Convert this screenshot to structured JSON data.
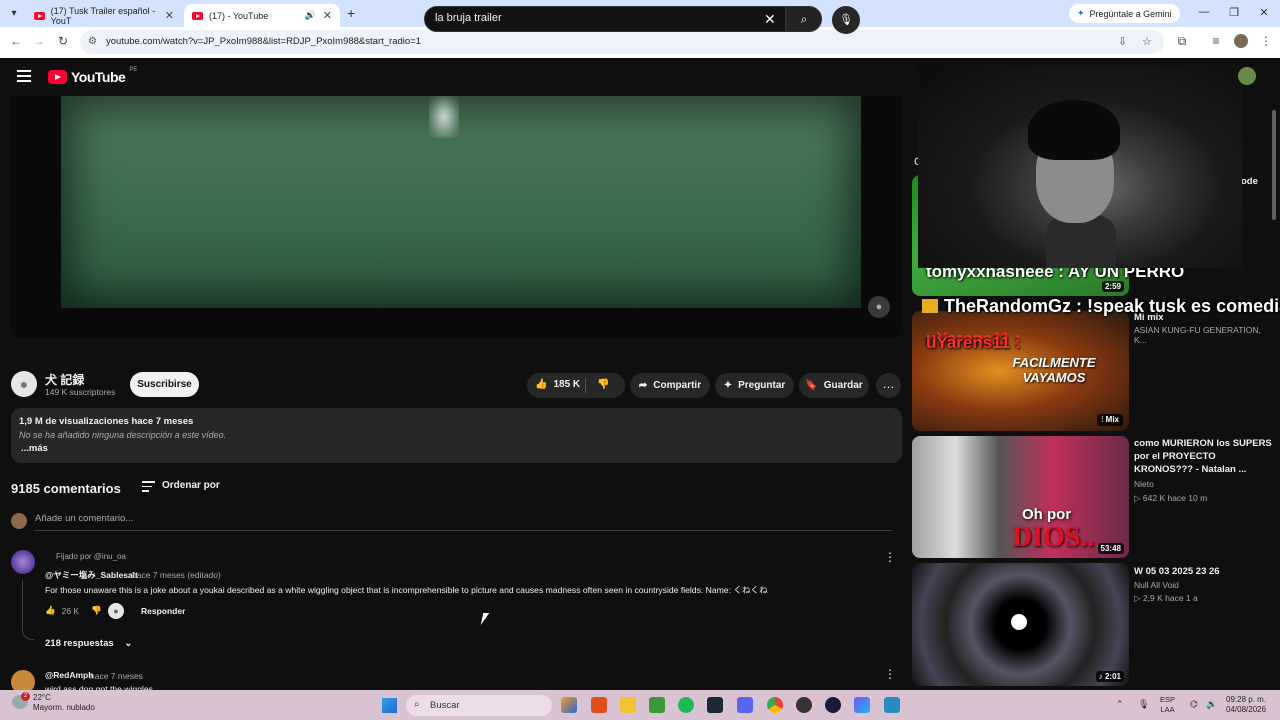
{
  "browser": {
    "tabs": [
      {
        "label": "(17) Tusk Trailer español - YouT",
        "active": false
      },
      {
        "label": "(17)       - YouTube",
        "active": true
      }
    ],
    "new_tab_icon": "plus-icon",
    "gemini_label": "Pregúntale a Gemini",
    "url": "youtube.com/watch?v=JP_PxoIm988&list=RDJP_PxoIm988&start_radio=1"
  },
  "youtube": {
    "logo_text": "YouTube",
    "country_code": "PE",
    "search": {
      "value": "la bruja trailer",
      "placeholder": "Buscar"
    }
  },
  "video": {
    "channel_name": "犬 記録",
    "subscribers": "149 K suscriptores",
    "subscribe_label": "Suscribirse",
    "likes": "185 K",
    "share_label": "Compartir",
    "ask_label": "Preguntar",
    "save_label": "Guardar",
    "stats": "1,9 M de visualizaciones  hace 7 meses",
    "description": "No se ha añadido ninguna descripción a este vídeo.",
    "more_label": "...más"
  },
  "comments": {
    "count_label": "9185 comentarios",
    "sort_label": "Ordenar por",
    "input_placeholder": "Añade un comentario...",
    "items": [
      {
        "pinned_label": "Fijado por @inu_oa",
        "author": "@ヤミー塩み_Sablesalt",
        "time": "hace 7 meses (editado)",
        "text": "For those unaware this is a joke about a youkai described as a white wiggling object that is incomprehensible to picture and causes madness often seen in countryside fields. Name: くねくね",
        "likes": "26 K",
        "reply_label": "Responder",
        "replies_label": "218 respuestas"
      },
      {
        "author": "@RedAmph",
        "time": "hace 7 meses",
        "text": "wird ass dog got the wiggles"
      }
    ]
  },
  "sidebar": {
    "cut_letter": "C",
    "cut_text": "ode",
    "items": [
      {
        "duration": "2:59"
      },
      {
        "title": "Mi mix",
        "channel": "ASIAN KUNG-FU GENERATION, K...",
        "badge": "Mix",
        "thumb_text1": "uYarens11 :",
        "thumb_text2": "FACILMENTE VAYAMOS"
      },
      {
        "title": "como MURIERON los SUPERS por el PROYECTO KRONOS??? - Natalan ...",
        "channel": "Nieto",
        "meta": "642 K  hace 10 m",
        "duration": "53:48",
        "thumb_text1": "Oh por",
        "thumb_text2": "DIOS.."
      },
      {
        "title": "W 05 03 2025 23 26",
        "channel": "Null All Void",
        "meta": "2,9 K  hace 1 a",
        "duration": "2:01"
      }
    ]
  },
  "overlay": {
    "chat": [
      "tomyxxhasheee : AY UN PERRO",
      "TheRandomGz : !speak tusk es comedia",
      "uYarens11 :"
    ]
  },
  "taskbar": {
    "weather_temp": "22°C",
    "weather_desc": "Mayorm. nublado",
    "weather_badge": "2",
    "search_label": "Buscar",
    "lang_top": "ESP",
    "lang_bottom": "LAA",
    "time": "09:28 p. m.",
    "date": "04/08/2026"
  }
}
